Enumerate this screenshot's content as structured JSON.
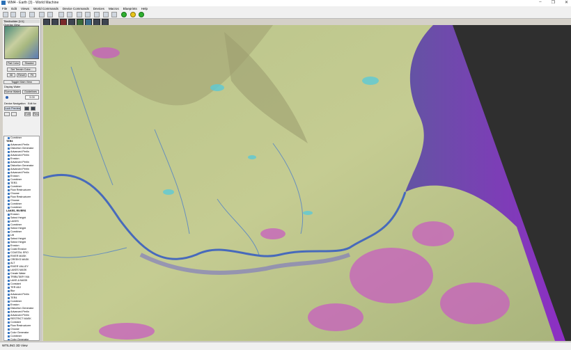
{
  "window": {
    "title": "WM4 - Earth (3) - World Machine",
    "controls": [
      "–",
      "❐",
      "✕"
    ]
  },
  "menu": [
    "File",
    "Edit",
    "Views",
    "World Commands",
    "Device Commands",
    "Devices",
    "Macros",
    "Blueprints",
    "Help"
  ],
  "sidebar": {
    "header": "Tiledbuilder [1/1]",
    "subheader": "Overlay View",
    "flat_color": "Flat Color",
    "shaded": "Shaded",
    "set_terrain_color": "Set Terrain Color...",
    "btn_3d": "3D",
    "reset": "Reset",
    "fit": "Fit",
    "toggle_main_view": "Toggle Main View",
    "display_water": "Display Water",
    "scene_water": "Scene Water",
    "guidelines": "Guidelines",
    "zoom_value": "9.00",
    "device_navigation": "Device Navigation",
    "edit_for": "Edit for",
    "lock_preview": "Lock Preview",
    "edit": "Edit",
    "res": "Res"
  },
  "tree": [
    {
      "label": "Combiner",
      "group": false
    },
    {
      "label": "TER3",
      "group": true
    },
    {
      "label": "Advanced Perlin",
      "group": false
    },
    {
      "label": "Distortion Generator",
      "group": false
    },
    {
      "label": "Advanced Perlin",
      "group": false
    },
    {
      "label": "Advanced Perlin",
      "group": false
    },
    {
      "label": "Erosion",
      "group": false
    },
    {
      "label": "Advanced Perlin",
      "group": false
    },
    {
      "label": "Distortion Generator",
      "group": false
    },
    {
      "label": "Advanced Perlin",
      "group": false
    },
    {
      "label": "Advanced Perlin",
      "group": false
    },
    {
      "label": "Erosion",
      "group": false
    },
    {
      "label": "Combiner",
      "group": false
    },
    {
      "label": "TER3",
      "group": false
    },
    {
      "label": "Combiner",
      "group": false
    },
    {
      "label": "Flow Restructurer",
      "group": false
    },
    {
      "label": "Choose",
      "group": false
    },
    {
      "label": "Flow Restructurer",
      "group": false
    },
    {
      "label": "Choose",
      "group": false
    },
    {
      "label": "Combiner",
      "group": false
    },
    {
      "label": "Combiner",
      "group": false
    },
    {
      "label": "LAKES, RIVERS",
      "group": true
    },
    {
      "label": "Erosion",
      "group": false
    },
    {
      "label": "Select Height",
      "group": false
    },
    {
      "label": "LAKES",
      "group": false
    },
    {
      "label": "Combiner",
      "group": false
    },
    {
      "label": "Select Height",
      "group": false
    },
    {
      "label": "Combiner",
      "group": false
    },
    {
      "label": "Lift",
      "group": false
    },
    {
      "label": "Select Height",
      "group": false
    },
    {
      "label": "Select Height",
      "group": false
    },
    {
      "label": "Erosion",
      "group": false
    },
    {
      "label": "Coast Erosion",
      "group": false
    },
    {
      "label": "COASTAL ERO",
      "group": false
    },
    {
      "label": "RIVER MASK",
      "group": false
    },
    {
      "label": "CREEKS MASK",
      "group": false
    },
    {
      "label": "ALT",
      "group": false
    },
    {
      "label": "RIVER VALLEY",
      "group": false
    },
    {
      "label": "LAKES MASK",
      "group": false
    },
    {
      "label": "Create Water",
      "group": false
    },
    {
      "label": "TRIBUTARY MA",
      "group": false
    },
    {
      "label": "LAKE-A MASK",
      "group": false
    },
    {
      "label": "Constant",
      "group": false
    },
    {
      "label": "TER ADJ",
      "group": false
    },
    {
      "label": "Blur",
      "group": false
    },
    {
      "label": "Advanced Perlin",
      "group": false
    },
    {
      "label": "TER4",
      "group": false
    },
    {
      "label": "Combiner",
      "group": false
    },
    {
      "label": "Erosion",
      "group": false
    },
    {
      "label": "Distortion Generator",
      "group": false
    },
    {
      "label": "Advanced Perlin",
      "group": false
    },
    {
      "label": "Advanced Perlin",
      "group": false
    },
    {
      "label": "RESTRICT MASK",
      "group": false
    },
    {
      "label": "Constant",
      "group": false
    },
    {
      "label": "Flow Restructurer",
      "group": false
    },
    {
      "label": "Choose",
      "group": false
    },
    {
      "label": "Color Generator",
      "group": false
    },
    {
      "label": "Combiner",
      "group": false
    },
    {
      "label": "Color Generator",
      "group": false
    },
    {
      "label": "Combiner",
      "group": false
    },
    {
      "label": "Overlay View",
      "group": false
    },
    {
      "label": "ELEVATION COLOR",
      "group": false
    }
  ],
  "status": "WTILING 3D View"
}
